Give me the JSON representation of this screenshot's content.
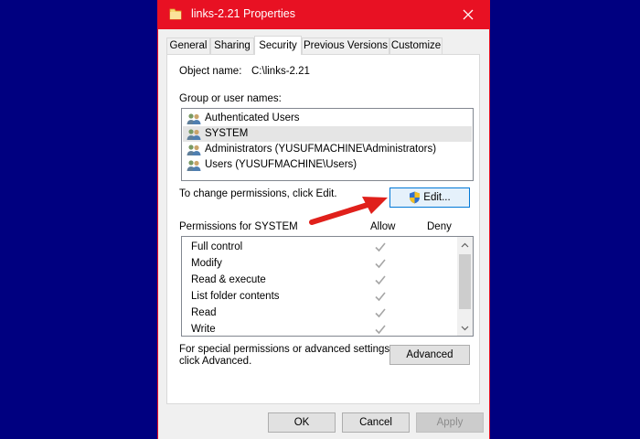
{
  "window": {
    "title": "links-2.21 Properties",
    "title_icon": "folder-icon",
    "accent_color": "#e81123"
  },
  "tabs": [
    {
      "label": "General"
    },
    {
      "label": "Sharing"
    },
    {
      "label": "Security",
      "active": true
    },
    {
      "label": "Previous Versions"
    },
    {
      "label": "Customize"
    }
  ],
  "security": {
    "object_name_label": "Object name:",
    "object_name_value": "C:\\links-2.21",
    "group_label": "Group or user names:",
    "users": [
      {
        "name": "Authenticated Users",
        "icon": "users-icon"
      },
      {
        "name": "SYSTEM",
        "icon": "users-icon",
        "selected": true
      },
      {
        "name": "Administrators (YUSUFMACHINE\\Administrators)",
        "icon": "users-icon"
      },
      {
        "name": "Users (YUSUFMACHINE\\Users)",
        "icon": "users-icon"
      }
    ],
    "change_text": "To change permissions, click Edit.",
    "edit_label": "Edit...",
    "permissions_header": "Permissions for SYSTEM",
    "allow_header": "Allow",
    "deny_header": "Deny",
    "permissions": [
      {
        "name": "Full control",
        "allow": true,
        "deny": false
      },
      {
        "name": "Modify",
        "allow": true,
        "deny": false
      },
      {
        "name": "Read & execute",
        "allow": true,
        "deny": false
      },
      {
        "name": "List folder contents",
        "allow": true,
        "deny": false
      },
      {
        "name": "Read",
        "allow": true,
        "deny": false
      },
      {
        "name": "Write",
        "allow": true,
        "deny": false
      }
    ],
    "special_text_line1": "For special permissions or advanced settings,",
    "special_text_line2": "click Advanced.",
    "advanced_label": "Advanced"
  },
  "footer": {
    "ok_label": "OK",
    "cancel_label": "Cancel",
    "apply_label": "Apply"
  },
  "annotation": {
    "arrow_color": "#e0201b"
  }
}
